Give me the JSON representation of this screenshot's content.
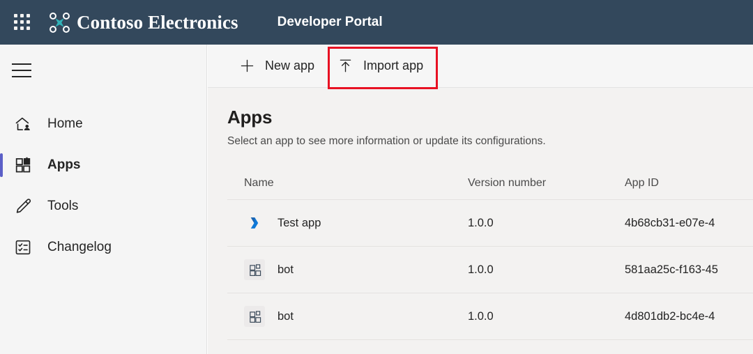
{
  "topbar": {
    "waffle_label": "app-launcher",
    "brand": "Contoso Electronics",
    "portal_title": "Developer Portal",
    "background": "#33485c",
    "logo_accent": "#31b3b8"
  },
  "sidebar": {
    "menu_label": "Navigation menu",
    "active_indicator_color": "#5b5fc7",
    "items": [
      {
        "label": "Home",
        "icon": "home-person-icon",
        "active": false
      },
      {
        "label": "Apps",
        "icon": "apps-grid-icon",
        "active": true
      },
      {
        "label": "Tools",
        "icon": "pencil-icon",
        "active": false
      },
      {
        "label": "Changelog",
        "icon": "task-list-icon",
        "active": false
      }
    ]
  },
  "toolbar": {
    "new_app_label": "New app",
    "import_app_label": "Import app",
    "highlight_color": "#e81123",
    "highlighted_button": "Import app"
  },
  "main": {
    "title": "Apps",
    "subtitle": "Select an app to see more information or update its configurations.",
    "table": {
      "columns": [
        "Name",
        "Version number",
        "App ID"
      ],
      "rows": [
        {
          "icon": "power-chevron-icon",
          "name": "Test app",
          "version": "1.0.0",
          "app_id": "4b68cb31-e07e-4"
        },
        {
          "icon": "teams-app-icon",
          "name": "bot",
          "version": "1.0.0",
          "app_id": "581aa25c-f163-45"
        },
        {
          "icon": "teams-app-icon",
          "name": "bot",
          "version": "1.0.0",
          "app_id": "4d801db2-bc4e-4"
        }
      ]
    }
  }
}
